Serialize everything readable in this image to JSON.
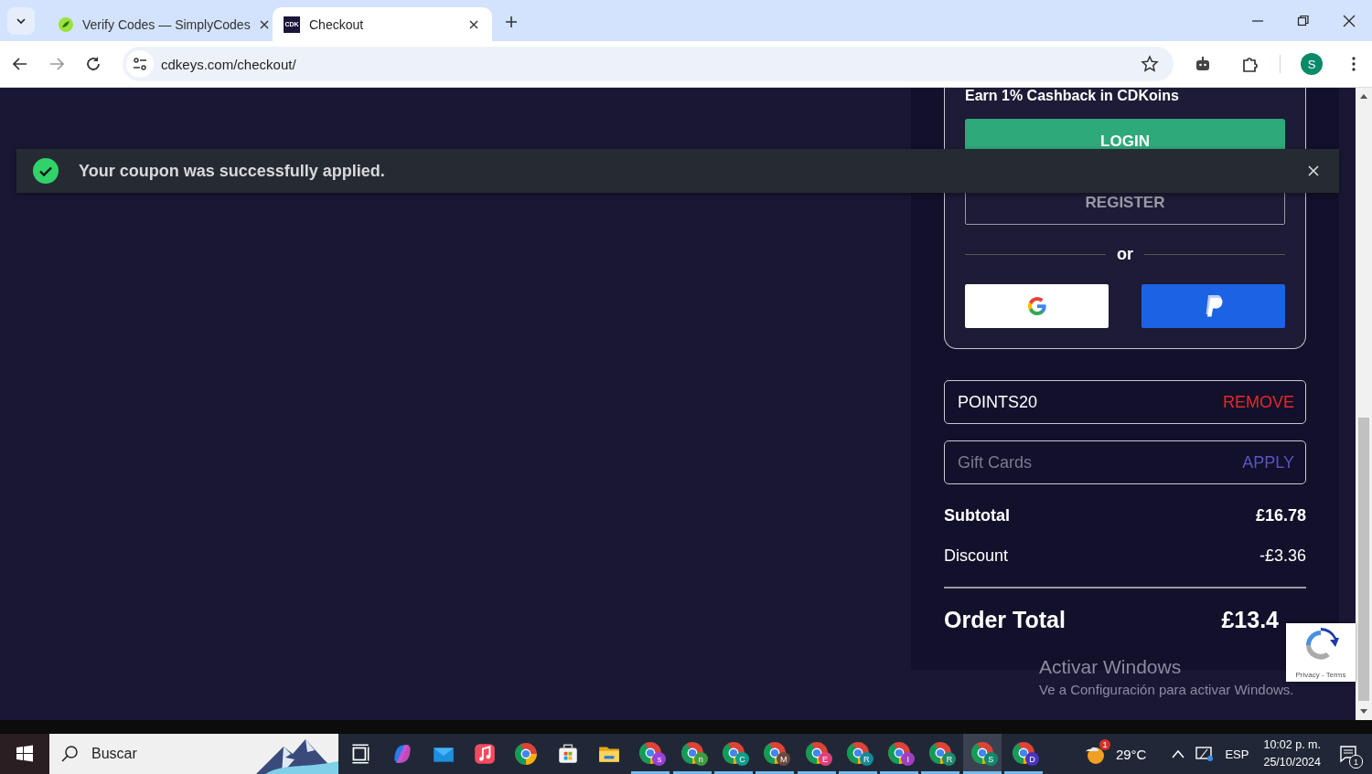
{
  "browser": {
    "tabs": [
      {
        "title": "Verify Codes — SimplyCodes",
        "selected": false,
        "kind": "simplycodes"
      },
      {
        "title": "Checkout",
        "selected": true,
        "kind": "cdk",
        "favicon_text": "CDK"
      }
    ],
    "address": "cdkeys.com/checkout/",
    "profile_initial": "S"
  },
  "toast": {
    "message": "Your coupon was successfully applied."
  },
  "account_card": {
    "cashback_text": "Earn 1% Cashback in CDKoins",
    "login": "LOGIN",
    "register": "REGISTER",
    "divider": "or"
  },
  "coupon": {
    "code": "POINTS20",
    "action": "REMOVE"
  },
  "gift_card": {
    "placeholder": "Gift Cards",
    "action": "APPLY"
  },
  "summary": [
    {
      "label": "Subtotal",
      "value": "£16.78",
      "bold": true
    },
    {
      "label": "Discount",
      "value": "-£3.36",
      "bold": false
    }
  ],
  "total": {
    "label": "Order Total",
    "value": "£13.4"
  },
  "recaptcha": {
    "text": "Privacy - Terms"
  },
  "windows_notice": {
    "title": "Activar Windows",
    "subtitle": "Ve a Configuración para activar Windows."
  },
  "taskbar": {
    "search_placeholder": "Buscar",
    "apps": [
      {
        "kind": "taskview",
        "running": false,
        "selected": false
      },
      {
        "kind": "copilot",
        "running": false,
        "selected": false
      },
      {
        "kind": "mail",
        "running": false,
        "selected": false
      },
      {
        "kind": "music",
        "running": false,
        "selected": false
      },
      {
        "kind": "chrome",
        "running": false,
        "selected": false
      },
      {
        "kind": "store",
        "running": false,
        "selected": false
      },
      {
        "kind": "folder",
        "running": false,
        "selected": false
      },
      {
        "kind": "chrome",
        "badge": "s",
        "color": "#9b3fd6",
        "running": true,
        "selected": false
      },
      {
        "kind": "chrome",
        "badge": "n",
        "color": "#3f9b3f",
        "running": true,
        "selected": false
      },
      {
        "kind": "chrome",
        "badge": "C",
        "color": "#0e9d8a",
        "running": true,
        "selected": false
      },
      {
        "kind": "chrome",
        "badge": "M",
        "color": "#6b4a3a",
        "running": true,
        "selected": false
      },
      {
        "kind": "chrome",
        "badge": "E",
        "color": "#e0407a",
        "running": true,
        "selected": false
      },
      {
        "kind": "chrome",
        "badge": "R",
        "color": "#138a9a",
        "running": true,
        "selected": false
      },
      {
        "kind": "chrome",
        "badge": "I",
        "color": "#a23fc0",
        "running": true,
        "selected": false
      },
      {
        "kind": "chrome",
        "badge": "R",
        "color": "#1f8a6a",
        "running": true,
        "selected": false
      },
      {
        "kind": "chrome",
        "badge": "S",
        "color": "#0e8a6a",
        "running": true,
        "selected": true
      },
      {
        "kind": "chrome",
        "badge": "D",
        "color": "#4a35c0",
        "running": true,
        "selected": false
      }
    ],
    "weather_badge": "1",
    "temperature": "29°C",
    "language": "ESP",
    "time": "10:02 p. m.",
    "date": "25/10/2024",
    "notification_count": "1"
  }
}
